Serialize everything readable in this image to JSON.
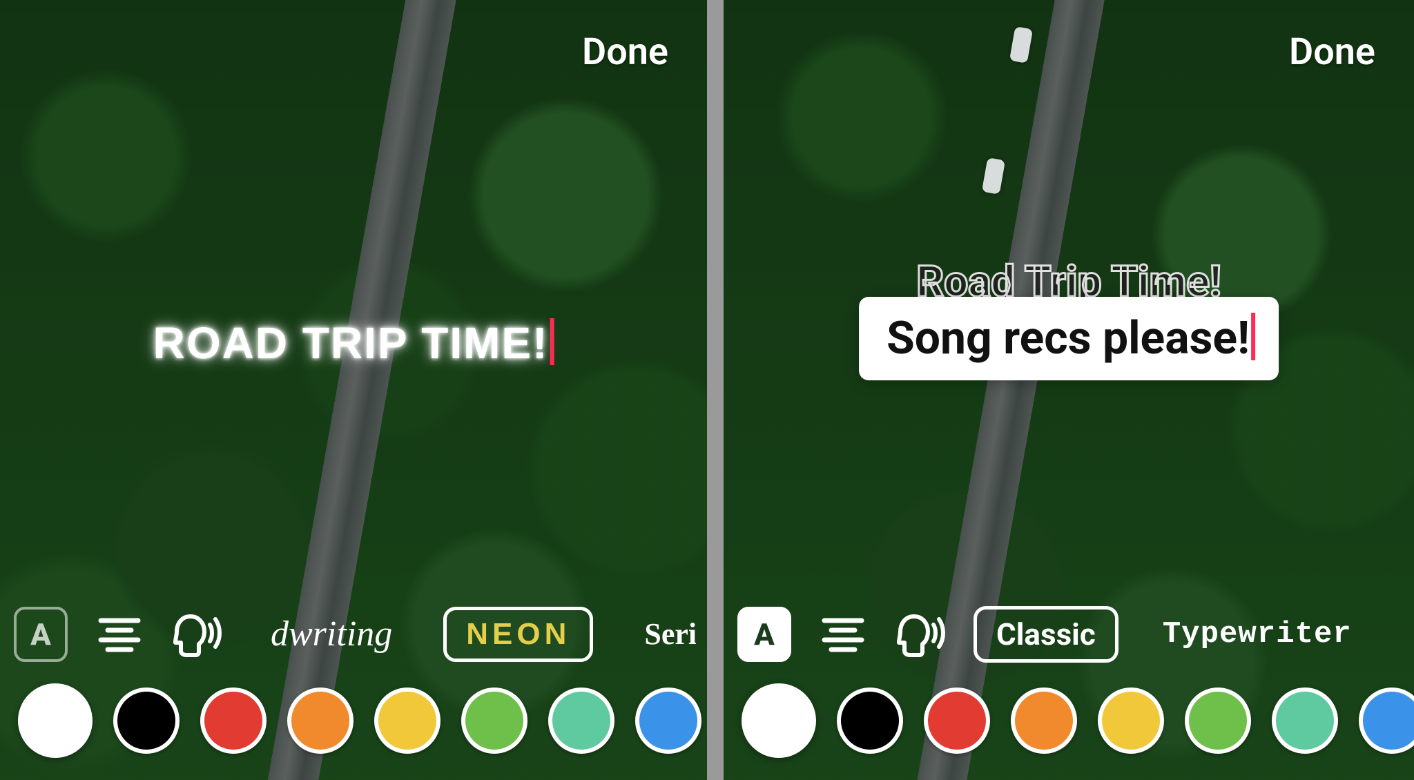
{
  "left": {
    "done_label": "Done",
    "overlay_text": "ROAD TRIP TIME!",
    "toolbar": {
      "text_style_state": "outline",
      "fonts": {
        "handwriting": "dwriting",
        "neon": "NEON",
        "serif": "Serif"
      }
    }
  },
  "right": {
    "done_label": "Done",
    "behind_text": "Road Trip Time!",
    "overlay_text": "Song recs please!",
    "toolbar": {
      "text_style_state": "filled",
      "fonts": {
        "classic": "Classic",
        "typewriter": "Typewriter"
      }
    }
  },
  "color_swatches": [
    "#ffffff",
    "#000000",
    "#e23b32",
    "#f08a2c",
    "#f2c83b",
    "#6fbf4b",
    "#5fc9a0",
    "#3a93e8",
    "#2b54d8"
  ],
  "icons": {
    "text_style": "A",
    "align": "align-center",
    "tts": "text-to-speech"
  }
}
